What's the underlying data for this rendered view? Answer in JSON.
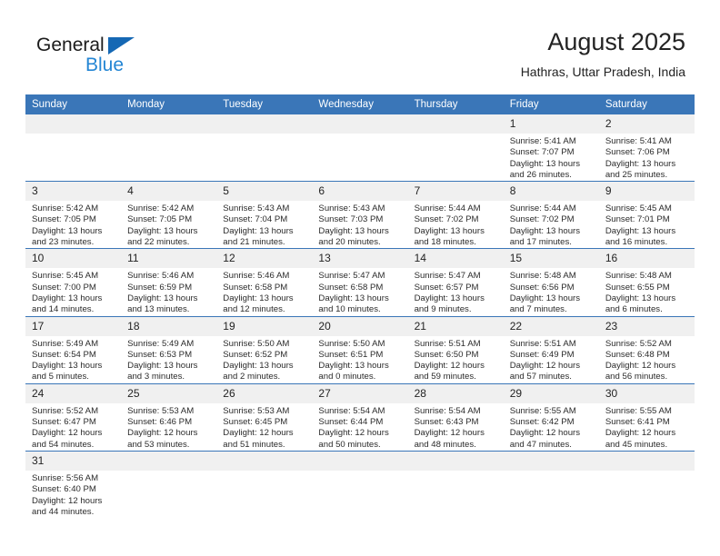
{
  "brand": {
    "name_top": "General",
    "name_bottom": "Blue",
    "triangle_color": "#1568b4",
    "blue_color": "#2486d4"
  },
  "header": {
    "title": "August 2025",
    "subtitle": "Hathras, Uttar Pradesh, India"
  },
  "colors": {
    "header_row": "#3a76b8",
    "daynum_band": "#f0f0f0",
    "text": "#2b2b2b"
  },
  "weekday_headers": [
    "Sunday",
    "Monday",
    "Tuesday",
    "Wednesday",
    "Thursday",
    "Friday",
    "Saturday"
  ],
  "weeks": [
    [
      {
        "day": "",
        "sunrise": "",
        "sunset": "",
        "daylight_line1": "",
        "daylight_line2": ""
      },
      {
        "day": "",
        "sunrise": "",
        "sunset": "",
        "daylight_line1": "",
        "daylight_line2": ""
      },
      {
        "day": "",
        "sunrise": "",
        "sunset": "",
        "daylight_line1": "",
        "daylight_line2": ""
      },
      {
        "day": "",
        "sunrise": "",
        "sunset": "",
        "daylight_line1": "",
        "daylight_line2": ""
      },
      {
        "day": "",
        "sunrise": "",
        "sunset": "",
        "daylight_line1": "",
        "daylight_line2": ""
      },
      {
        "day": "1",
        "sunrise": "Sunrise: 5:41 AM",
        "sunset": "Sunset: 7:07 PM",
        "daylight_line1": "Daylight: 13 hours",
        "daylight_line2": "and 26 minutes."
      },
      {
        "day": "2",
        "sunrise": "Sunrise: 5:41 AM",
        "sunset": "Sunset: 7:06 PM",
        "daylight_line1": "Daylight: 13 hours",
        "daylight_line2": "and 25 minutes."
      }
    ],
    [
      {
        "day": "3",
        "sunrise": "Sunrise: 5:42 AM",
        "sunset": "Sunset: 7:05 PM",
        "daylight_line1": "Daylight: 13 hours",
        "daylight_line2": "and 23 minutes."
      },
      {
        "day": "4",
        "sunrise": "Sunrise: 5:42 AM",
        "sunset": "Sunset: 7:05 PM",
        "daylight_line1": "Daylight: 13 hours",
        "daylight_line2": "and 22 minutes."
      },
      {
        "day": "5",
        "sunrise": "Sunrise: 5:43 AM",
        "sunset": "Sunset: 7:04 PM",
        "daylight_line1": "Daylight: 13 hours",
        "daylight_line2": "and 21 minutes."
      },
      {
        "day": "6",
        "sunrise": "Sunrise: 5:43 AM",
        "sunset": "Sunset: 7:03 PM",
        "daylight_line1": "Daylight: 13 hours",
        "daylight_line2": "and 20 minutes."
      },
      {
        "day": "7",
        "sunrise": "Sunrise: 5:44 AM",
        "sunset": "Sunset: 7:02 PM",
        "daylight_line1": "Daylight: 13 hours",
        "daylight_line2": "and 18 minutes."
      },
      {
        "day": "8",
        "sunrise": "Sunrise: 5:44 AM",
        "sunset": "Sunset: 7:02 PM",
        "daylight_line1": "Daylight: 13 hours",
        "daylight_line2": "and 17 minutes."
      },
      {
        "day": "9",
        "sunrise": "Sunrise: 5:45 AM",
        "sunset": "Sunset: 7:01 PM",
        "daylight_line1": "Daylight: 13 hours",
        "daylight_line2": "and 16 minutes."
      }
    ],
    [
      {
        "day": "10",
        "sunrise": "Sunrise: 5:45 AM",
        "sunset": "Sunset: 7:00 PM",
        "daylight_line1": "Daylight: 13 hours",
        "daylight_line2": "and 14 minutes."
      },
      {
        "day": "11",
        "sunrise": "Sunrise: 5:46 AM",
        "sunset": "Sunset: 6:59 PM",
        "daylight_line1": "Daylight: 13 hours",
        "daylight_line2": "and 13 minutes."
      },
      {
        "day": "12",
        "sunrise": "Sunrise: 5:46 AM",
        "sunset": "Sunset: 6:58 PM",
        "daylight_line1": "Daylight: 13 hours",
        "daylight_line2": "and 12 minutes."
      },
      {
        "day": "13",
        "sunrise": "Sunrise: 5:47 AM",
        "sunset": "Sunset: 6:58 PM",
        "daylight_line1": "Daylight: 13 hours",
        "daylight_line2": "and 10 minutes."
      },
      {
        "day": "14",
        "sunrise": "Sunrise: 5:47 AM",
        "sunset": "Sunset: 6:57 PM",
        "daylight_line1": "Daylight: 13 hours",
        "daylight_line2": "and 9 minutes."
      },
      {
        "day": "15",
        "sunrise": "Sunrise: 5:48 AM",
        "sunset": "Sunset: 6:56 PM",
        "daylight_line1": "Daylight: 13 hours",
        "daylight_line2": "and 7 minutes."
      },
      {
        "day": "16",
        "sunrise": "Sunrise: 5:48 AM",
        "sunset": "Sunset: 6:55 PM",
        "daylight_line1": "Daylight: 13 hours",
        "daylight_line2": "and 6 minutes."
      }
    ],
    [
      {
        "day": "17",
        "sunrise": "Sunrise: 5:49 AM",
        "sunset": "Sunset: 6:54 PM",
        "daylight_line1": "Daylight: 13 hours",
        "daylight_line2": "and 5 minutes."
      },
      {
        "day": "18",
        "sunrise": "Sunrise: 5:49 AM",
        "sunset": "Sunset: 6:53 PM",
        "daylight_line1": "Daylight: 13 hours",
        "daylight_line2": "and 3 minutes."
      },
      {
        "day": "19",
        "sunrise": "Sunrise: 5:50 AM",
        "sunset": "Sunset: 6:52 PM",
        "daylight_line1": "Daylight: 13 hours",
        "daylight_line2": "and 2 minutes."
      },
      {
        "day": "20",
        "sunrise": "Sunrise: 5:50 AM",
        "sunset": "Sunset: 6:51 PM",
        "daylight_line1": "Daylight: 13 hours",
        "daylight_line2": "and 0 minutes."
      },
      {
        "day": "21",
        "sunrise": "Sunrise: 5:51 AM",
        "sunset": "Sunset: 6:50 PM",
        "daylight_line1": "Daylight: 12 hours",
        "daylight_line2": "and 59 minutes."
      },
      {
        "day": "22",
        "sunrise": "Sunrise: 5:51 AM",
        "sunset": "Sunset: 6:49 PM",
        "daylight_line1": "Daylight: 12 hours",
        "daylight_line2": "and 57 minutes."
      },
      {
        "day": "23",
        "sunrise": "Sunrise: 5:52 AM",
        "sunset": "Sunset: 6:48 PM",
        "daylight_line1": "Daylight: 12 hours",
        "daylight_line2": "and 56 minutes."
      }
    ],
    [
      {
        "day": "24",
        "sunrise": "Sunrise: 5:52 AM",
        "sunset": "Sunset: 6:47 PM",
        "daylight_line1": "Daylight: 12 hours",
        "daylight_line2": "and 54 minutes."
      },
      {
        "day": "25",
        "sunrise": "Sunrise: 5:53 AM",
        "sunset": "Sunset: 6:46 PM",
        "daylight_line1": "Daylight: 12 hours",
        "daylight_line2": "and 53 minutes."
      },
      {
        "day": "26",
        "sunrise": "Sunrise: 5:53 AM",
        "sunset": "Sunset: 6:45 PM",
        "daylight_line1": "Daylight: 12 hours",
        "daylight_line2": "and 51 minutes."
      },
      {
        "day": "27",
        "sunrise": "Sunrise: 5:54 AM",
        "sunset": "Sunset: 6:44 PM",
        "daylight_line1": "Daylight: 12 hours",
        "daylight_line2": "and 50 minutes."
      },
      {
        "day": "28",
        "sunrise": "Sunrise: 5:54 AM",
        "sunset": "Sunset: 6:43 PM",
        "daylight_line1": "Daylight: 12 hours",
        "daylight_line2": "and 48 minutes."
      },
      {
        "day": "29",
        "sunrise": "Sunrise: 5:55 AM",
        "sunset": "Sunset: 6:42 PM",
        "daylight_line1": "Daylight: 12 hours",
        "daylight_line2": "and 47 minutes."
      },
      {
        "day": "30",
        "sunrise": "Sunrise: 5:55 AM",
        "sunset": "Sunset: 6:41 PM",
        "daylight_line1": "Daylight: 12 hours",
        "daylight_line2": "and 45 minutes."
      }
    ],
    [
      {
        "day": "31",
        "sunrise": "Sunrise: 5:56 AM",
        "sunset": "Sunset: 6:40 PM",
        "daylight_line1": "Daylight: 12 hours",
        "daylight_line2": "and 44 minutes."
      },
      {
        "day": "",
        "sunrise": "",
        "sunset": "",
        "daylight_line1": "",
        "daylight_line2": ""
      },
      {
        "day": "",
        "sunrise": "",
        "sunset": "",
        "daylight_line1": "",
        "daylight_line2": ""
      },
      {
        "day": "",
        "sunrise": "",
        "sunset": "",
        "daylight_line1": "",
        "daylight_line2": ""
      },
      {
        "day": "",
        "sunrise": "",
        "sunset": "",
        "daylight_line1": "",
        "daylight_line2": ""
      },
      {
        "day": "",
        "sunrise": "",
        "sunset": "",
        "daylight_line1": "",
        "daylight_line2": ""
      },
      {
        "day": "",
        "sunrise": "",
        "sunset": "",
        "daylight_line1": "",
        "daylight_line2": ""
      }
    ]
  ]
}
